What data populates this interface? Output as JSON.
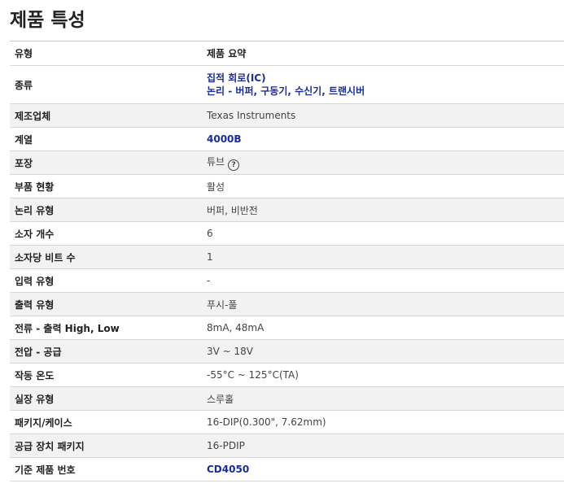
{
  "page_title": "제품 특성",
  "table": {
    "header": {
      "col1": "유형",
      "col2": "제품 요약"
    },
    "rows": {
      "category": {
        "label": "종류",
        "links": [
          "집적 회로(IC)",
          "논리 - 버퍼, 구동기, 수신기, 트랜시버"
        ]
      },
      "manufacturer": {
        "label": "제조업체",
        "value": "Texas Instruments"
      },
      "series": {
        "label": "계열",
        "value": "4000B"
      },
      "packaging": {
        "label": "포장",
        "value": "튜브",
        "help_icon": "question-circle-icon",
        "help_symbol": "?"
      },
      "part_status": {
        "label": "부품 현황",
        "value": "활성"
      },
      "logic_type": {
        "label": "논리 유형",
        "value": "버퍼, 비반전"
      },
      "num_elements": {
        "label": "소자 개수",
        "value": "6"
      },
      "bits_per_element": {
        "label": "소자당 비트 수",
        "value": "1"
      },
      "input_type": {
        "label": "입력 유형",
        "value": "-"
      },
      "output_type": {
        "label": "출력 유형",
        "value": "푸시-풀"
      },
      "current_output": {
        "label": "전류 - 출력 High, Low",
        "value": "8mA, 48mA"
      },
      "voltage_supply": {
        "label": "전압 - 공급",
        "value": "3V ~ 18V"
      },
      "operating_temp": {
        "label": "작동 온도",
        "value": "-55°C ~ 125°C(TA)"
      },
      "mounting_type": {
        "label": "실장 유형",
        "value": "스루홀"
      },
      "package_case": {
        "label": "패키지/케이스",
        "value": "16-DIP(0.300\", 7.62mm)"
      },
      "supplier_package": {
        "label": "공급 장치 패키지",
        "value": "16-PDIP"
      },
      "base_product_number": {
        "label": "기준 제품 번호",
        "value": "CD4050"
      }
    }
  },
  "colors": {
    "link": "#1a2b9c",
    "stripe": "#f2f2f2",
    "border": "#d6d6d6"
  }
}
